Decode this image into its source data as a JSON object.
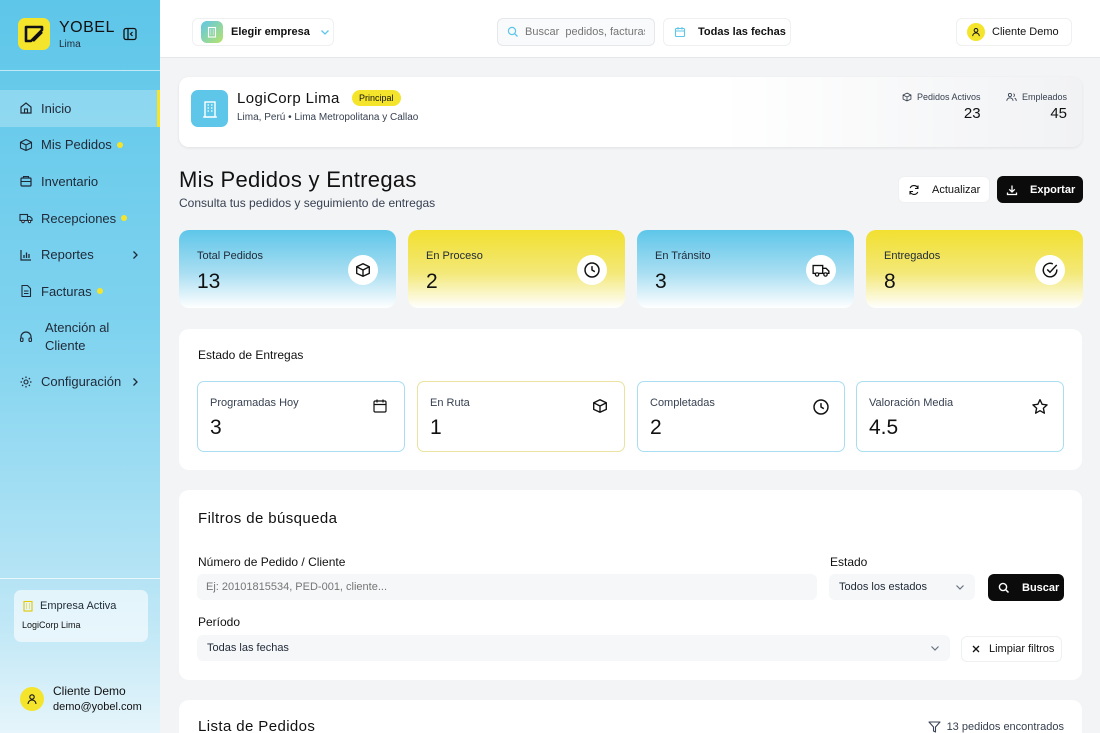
{
  "sidebar": {
    "brand_name": "YOBEL",
    "brand_city": "Lima",
    "items": [
      {
        "label": "Inicio",
        "icon": "home-icon",
        "active": true
      },
      {
        "label": "Mis Pedidos",
        "icon": "package-icon",
        "dot": true
      },
      {
        "label": "Inventario",
        "icon": "inventory-icon"
      },
      {
        "label": "Recepciones",
        "icon": "truck-icon",
        "dot": true
      },
      {
        "label": "Reportes",
        "icon": "bar-chart-icon",
        "chevron": true
      },
      {
        "label": "Facturas",
        "icon": "document-icon",
        "dot": true
      },
      {
        "label": "Atención al Cliente",
        "icon": "headset-icon"
      },
      {
        "label": "Configuración",
        "icon": "gear-icon",
        "chevron": true
      }
    ],
    "active_company": {
      "title": "Empresa Activa",
      "name": "LogiCorp Lima"
    },
    "user": {
      "name": "Cliente Demo",
      "email": "demo@yobel.com"
    }
  },
  "topbar": {
    "company_select": "Elegir empresa",
    "search_placeholder": "Buscar  pedidos, facturas",
    "date_filter": "Todas las fechas",
    "user": "Cliente Demo"
  },
  "company": {
    "name": "LogiCorp Lima",
    "badge": "Principal",
    "location": "Lima, Perú • Lima Metropolitana y Callao",
    "active_orders_label": "Pedidos Activos",
    "active_orders_value": "23",
    "employees_label": "Empleados",
    "employees_value": "45"
  },
  "header": {
    "title": "Mis Pedidos y Entregas",
    "subtitle": "Consulta tus pedidos y seguimiento de entregas",
    "refresh": "Actualizar",
    "export": "Exportar"
  },
  "kpis": [
    {
      "label": "Total Pedidos",
      "value": "13",
      "icon": "package-icon"
    },
    {
      "label": "En Proceso",
      "value": "2",
      "icon": "clock-icon"
    },
    {
      "label": "En Tránsito",
      "value": "3",
      "icon": "truck-icon"
    },
    {
      "label": "Entregados",
      "value": "8",
      "icon": "check-circle-icon"
    }
  ],
  "deliveries": {
    "title": "Estado de Entregas",
    "items": [
      {
        "label": "Programadas Hoy",
        "value": "3",
        "icon": "calendar-icon"
      },
      {
        "label": "En Ruta",
        "value": "1",
        "icon": "package-icon"
      },
      {
        "label": "Completadas",
        "value": "2",
        "icon": "clock-icon"
      },
      {
        "label": "Valoración Media",
        "value": "4.5",
        "icon": "star-icon"
      }
    ]
  },
  "filters": {
    "title": "Filtros de búsqueda",
    "order_label": "Número de Pedido / Cliente",
    "order_placeholder": "Ej: 20101815534, PED-001, cliente...",
    "status_label": "Estado",
    "status_value": "Todos los estados",
    "search_button": "Buscar",
    "period_label": "Período",
    "period_value": "Todas las fechas",
    "clear_button": "Limpiar filtros"
  },
  "orders_list": {
    "title": "Lista de Pedidos",
    "count": "13 pedidos encontrados"
  },
  "colors": {
    "accent_yellow": "#f5e42c",
    "accent_blue": "#5ec6e9",
    "dark": "#0b0b0b"
  }
}
